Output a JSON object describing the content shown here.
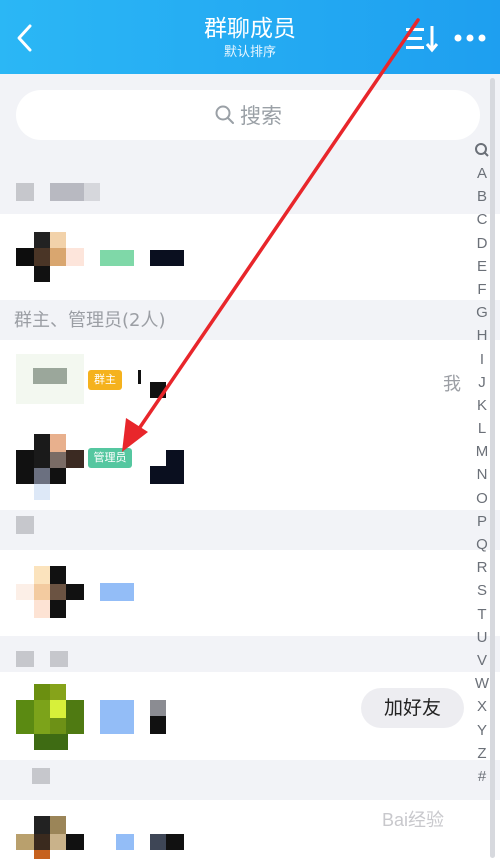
{
  "header": {
    "title": "群聊成员",
    "subtitle": "默认排序",
    "back_icon": "chevron-left-icon",
    "sort_icon": "sort-list-icon",
    "more_icon": "more-dots-icon"
  },
  "search": {
    "placeholder": "搜索",
    "icon": "search-icon"
  },
  "sections": {
    "admins_title": "群主、管理员(2人)"
  },
  "members": {
    "owner_badge": "群主",
    "admin_badge": "管理员",
    "me_label": "我",
    "add_friend_label": "加好友"
  },
  "index_bar": [
    "A",
    "B",
    "C",
    "D",
    "E",
    "F",
    "G",
    "H",
    "I",
    "J",
    "K",
    "L",
    "M",
    "N",
    "O",
    "P",
    "Q",
    "R",
    "S",
    "T",
    "U",
    "V",
    "W",
    "X",
    "Y",
    "Z",
    "#"
  ],
  "index_search_icon": "search-icon",
  "colors": {
    "header_gradient_start": "#2bb7f5",
    "header_gradient_end": "#1e9ff0",
    "owner_badge": "#f5b21d",
    "admin_badge": "#55c7a0",
    "annotation_arrow": "#e8262b"
  },
  "watermark": "Bai经验"
}
